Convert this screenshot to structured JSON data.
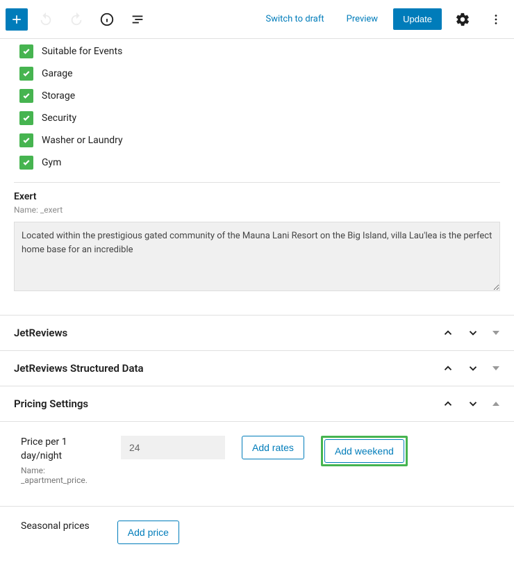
{
  "toolbar": {
    "switch_to_draft": "Switch to draft",
    "preview": "Preview",
    "update": "Update"
  },
  "amenities": [
    {
      "label": "Suitable for Events"
    },
    {
      "label": "Garage"
    },
    {
      "label": "Storage"
    },
    {
      "label": "Security"
    },
    {
      "label": "Washer or Laundry"
    },
    {
      "label": "Gym"
    }
  ],
  "exert": {
    "title": "Exert",
    "name_label": "Name: _exert",
    "value": "Located within the prestigious gated community of the Mauna Lani Resort on the Big Island, villa Lau'lea is the perfect home base for an incredible"
  },
  "panels": {
    "jetreviews": "JetReviews",
    "jetreviews_sd": "JetReviews Structured Data",
    "pricing": "Pricing Settings"
  },
  "pricing": {
    "price_label": "Price per 1 day/night",
    "price_name": "Name: _apartment_price.",
    "price_value": "24",
    "add_rates": "Add rates",
    "add_weekend": "Add weekend",
    "seasonal_label": "Seasonal prices",
    "add_price": "Add price"
  }
}
